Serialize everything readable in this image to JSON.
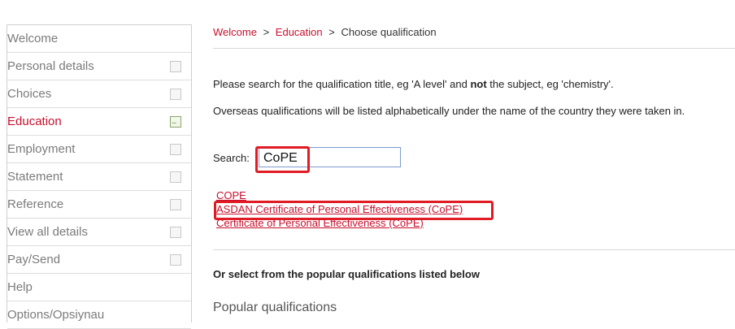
{
  "sidebar": {
    "items": [
      {
        "label": "Welcome",
        "has_checkbox": false,
        "active": false
      },
      {
        "label": "Personal details",
        "has_checkbox": true,
        "active": false
      },
      {
        "label": "Choices",
        "has_checkbox": true,
        "active": false
      },
      {
        "label": "Education",
        "has_checkbox": true,
        "active": true,
        "status": "..."
      },
      {
        "label": "Employment",
        "has_checkbox": true,
        "active": false
      },
      {
        "label": "Statement",
        "has_checkbox": true,
        "active": false
      },
      {
        "label": "Reference",
        "has_checkbox": true,
        "active": false
      },
      {
        "label": "View all details",
        "has_checkbox": true,
        "active": false
      },
      {
        "label": "Pay/Send",
        "has_checkbox": true,
        "active": false
      },
      {
        "label": "Help",
        "has_checkbox": false,
        "active": false
      },
      {
        "label": "Options/Opsiynau",
        "has_checkbox": false,
        "active": false
      }
    ]
  },
  "breadcrumb": {
    "welcome": "Welcome",
    "sep": ">",
    "education": "Education",
    "current": "Choose qualification"
  },
  "instructions": {
    "line1_a": "Please search for the qualification title, eg 'A level' and ",
    "line1_bold": "not",
    "line1_b": " the subject, eg 'chemistry'.",
    "line2": "Overseas qualifications will be listed alphabetically under the name of the country they were taken in."
  },
  "search": {
    "label": "Search:",
    "value": "CoPE"
  },
  "results": [
    "COPE",
    "ASDAN Certificate of Personal Effectiveness (CoPE)",
    "Certificate of Personal Effectiveness (CoPE)"
  ],
  "popular": {
    "prompt": "Or select from the popular qualifications listed below",
    "heading": "Popular qualifications"
  },
  "colors": {
    "accent": "#c8102e",
    "highlight": "#e01b24"
  }
}
